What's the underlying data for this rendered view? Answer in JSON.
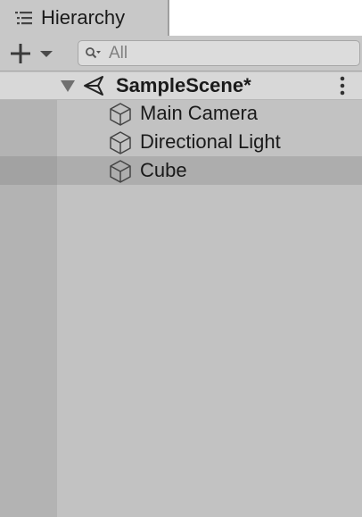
{
  "window": {
    "tab_title": "Hierarchy",
    "tab_icon": "list-icon"
  },
  "toolbar": {
    "add_icon": "plus-icon",
    "dropdown_icon": "triangle-down-icon",
    "search": {
      "placeholder": "All",
      "value": "",
      "icon": "search-icon"
    }
  },
  "scene": {
    "name": "SampleScene*",
    "icon": "unity-logo-icon",
    "expanded": true,
    "menu_icon": "kebab-menu-icon"
  },
  "objects": [
    {
      "label": "Main Camera",
      "icon": "cube-icon",
      "selected": false
    },
    {
      "label": "Directional Light",
      "icon": "cube-icon",
      "selected": false
    },
    {
      "label": "Cube",
      "icon": "cube-icon",
      "selected": true
    }
  ],
  "colors": {
    "panel_bg": "#c2c2c2",
    "gutter_bg": "#b3b3b3",
    "selected_row": "#adadad",
    "scene_header": "#d8d8d8"
  }
}
